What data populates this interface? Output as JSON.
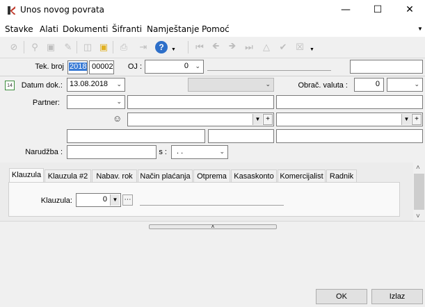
{
  "window": {
    "title": "Unos novog povrata"
  },
  "menu": [
    "Stavke",
    "Alati",
    "Dokumenti",
    "Šifranti",
    "Namještanje",
    "Pomoć"
  ],
  "header": {
    "tek_broj_label": "Tek. broj",
    "tek_broj_year": "2018",
    "tek_broj_number": "00002",
    "oj_label": "OJ :",
    "oj_value": "0"
  },
  "form": {
    "datum_label": "Datum dok.:",
    "datum_value": "13.08.2018",
    "obrac_valuta_label": "Obrač. valuta :",
    "obrac_valuta_value": "0",
    "partner_label": "Partner:",
    "narudzba_label": "Narudžba :",
    "s_label": "s :",
    "s_value": ". ."
  },
  "tabs": [
    "Klauzula",
    "Klauzula #2",
    "Nabav. rok",
    "Način plaćanja",
    "Otprema",
    "Kasaskonto",
    "Komercijalist",
    "Radnik"
  ],
  "active_tab": "Klauzula",
  "tab_content": {
    "klauzula_label": "Klauzula:",
    "klauzula_value": "0"
  },
  "buttons": {
    "ok": "OK",
    "izlaz": "Izlaz"
  },
  "icons": {
    "calendar_day": "14",
    "window_controls": [
      "minimize-icon",
      "maximize-icon",
      "close-icon"
    ],
    "toolbar": [
      "cancel-icon",
      "search-icon",
      "save-icon",
      "edit-icon",
      "delete-icon",
      "lock-icon",
      "print-icon",
      "export-icon",
      "help-icon",
      "first-icon",
      "prev-icon",
      "next-icon",
      "last-icon",
      "up-icon",
      "confirm-icon",
      "clear-icon"
    ]
  }
}
